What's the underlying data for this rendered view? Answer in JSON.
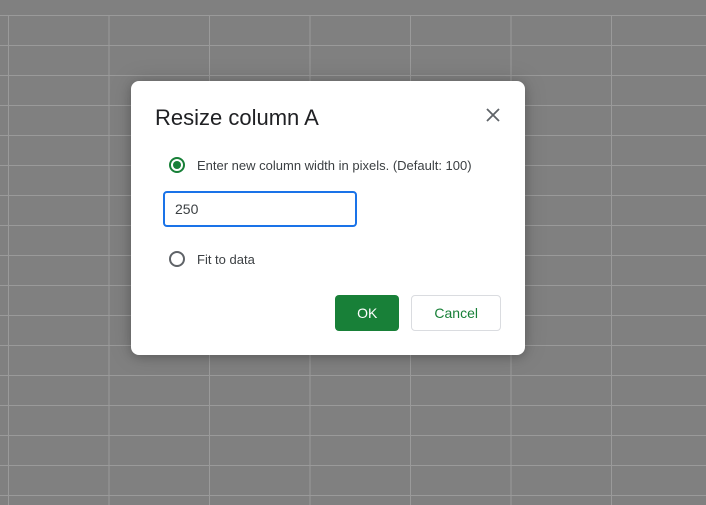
{
  "dialog": {
    "title": "Resize column A",
    "option_enter_width": "Enter new column width in pixels. (Default: 100)",
    "input_value": "250",
    "option_fit": "Fit to data",
    "ok_label": "OK",
    "cancel_label": "Cancel"
  }
}
